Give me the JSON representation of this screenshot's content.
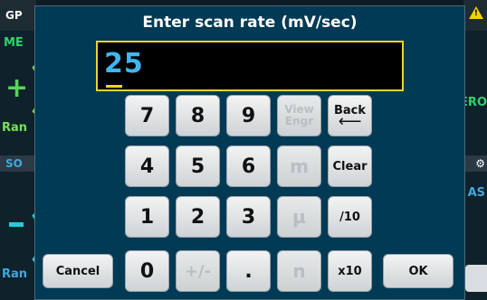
{
  "background": {
    "top_left_label": "GP",
    "meas_label": "ME",
    "range_label_top": "Ran",
    "source_label": "SO",
    "range_label_bottom": "Ran",
    "right_label_top": "ERO",
    "right_label_mid": "AS"
  },
  "dialog": {
    "title": "Enter scan rate (mV/sec)",
    "value": "25"
  },
  "keypad": {
    "k7": "7",
    "k8": "8",
    "k9": "9",
    "view_line1": "View",
    "view_line2": "Engr",
    "back_label": "Back",
    "back_arrow": "⟵",
    "k4": "4",
    "k5": "5",
    "k6": "6",
    "milli": "m",
    "clear": "Clear",
    "k1": "1",
    "k2": "2",
    "k3": "3",
    "micro": "µ",
    "div10": "/10",
    "cancel": "Cancel",
    "k0": "0",
    "plusminus": "+/-",
    "dot": ".",
    "nano": "n",
    "x10": "x10",
    "ok": "OK"
  },
  "colors": {
    "dialog_bg": "#003a55",
    "entry_border": "#e8d42a",
    "entry_text": "#3fb6f0"
  }
}
